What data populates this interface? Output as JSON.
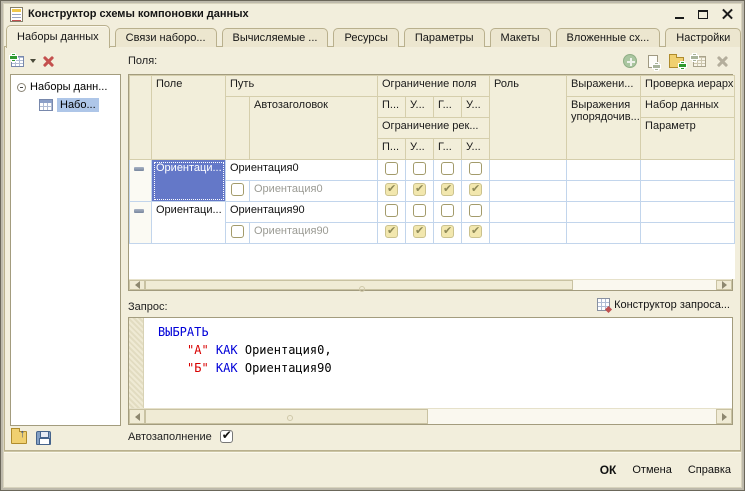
{
  "window": {
    "title": "Конструктор схемы компоновки данных"
  },
  "tabs": [
    {
      "label": "Наборы данных",
      "active": true
    },
    {
      "label": "Связи наборо...",
      "active": false
    },
    {
      "label": "Вычисляемые ...",
      "active": false
    },
    {
      "label": "Ресурсы",
      "active": false
    },
    {
      "label": "Параметры",
      "active": false
    },
    {
      "label": "Макеты",
      "active": false
    },
    {
      "label": "Вложенные сх...",
      "active": false
    },
    {
      "label": "Настройки",
      "active": false
    }
  ],
  "sidebar": {
    "tree_root": "Наборы данн...",
    "tree_child": "Набо...",
    "toolbar_icons": [
      "add-dataset",
      "delete-dataset"
    ],
    "bottom_icons": [
      "load-schema",
      "save-schema"
    ]
  },
  "fields_panel": {
    "label": "Поля:",
    "toolbar_icons": [
      "add-circle",
      "copy-add",
      "folder-add",
      "table-add",
      "delete"
    ],
    "columns": {
      "field": "Поле",
      "path": "Путь",
      "autoheader": "Автозаголовок",
      "field_restriction": "Ограничение поля",
      "record_restriction": "Ограничение рек...",
      "restriction_cols": [
        "П...",
        "У...",
        "Г...",
        "У..."
      ],
      "role": "Роль",
      "expression": "Выражени...",
      "order_expressions": "Выражения упорядочив...",
      "hierarchy_check": "Проверка иерархи",
      "dataset": "Набор данных",
      "parameter": "Параметр"
    },
    "rows": [
      {
        "field": "Ориентаци...",
        "path": "Ориентация0",
        "autoheader": "Ориентация0",
        "selected": true,
        "restrictions": [
          false,
          false,
          false,
          false
        ],
        "auto_restrictions": [
          true,
          true,
          true,
          true
        ]
      },
      {
        "field": "Ориентаци...",
        "path": "Ориентация90",
        "autoheader": "Ориентация90",
        "selected": false,
        "restrictions": [
          false,
          false,
          false,
          false
        ],
        "auto_restrictions": [
          true,
          true,
          true,
          true
        ]
      }
    ]
  },
  "query_panel": {
    "label": "Запрос:",
    "designer_button": "Конструктор запроса...",
    "select_keyword": "ВЫБРАТЬ",
    "lines": [
      {
        "string": "\"А\"",
        "keyword": "КАК",
        "identifier": "Ориентация0,"
      },
      {
        "string": "\"Б\"",
        "keyword": "КАК",
        "identifier": "Ориентация90"
      }
    ]
  },
  "autofill": {
    "label": "Автозаполнение",
    "checked": true
  },
  "footer": {
    "ok": "ОК",
    "cancel": "Отмена",
    "help": "Справка"
  },
  "colors": {
    "background": "#f2eedc",
    "selection": "#6478c8",
    "tree_selection": "#aec6e8",
    "grid_line": "#c2d5ec",
    "header_border": "#d5ceac",
    "keyword": "#0000d8",
    "string_literal": "#d80000"
  }
}
